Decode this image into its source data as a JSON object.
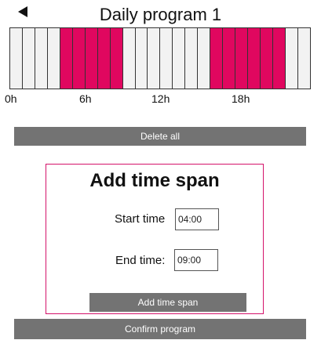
{
  "header": {
    "title": "Daily program 1",
    "back_icon": "back-arrow-icon"
  },
  "timeline": {
    "slots_per_day": 24,
    "active_hours": [
      4,
      5,
      6,
      7,
      8,
      16,
      17,
      18,
      19,
      20,
      21
    ],
    "active_color": "#e0075f",
    "inactive_color": "#f2f2f2",
    "hour_labels": [
      "0h",
      "6h",
      "12h",
      "18h"
    ]
  },
  "delete_all_label": "Delete all",
  "add_panel": {
    "title": "Add time span",
    "start_label": "Start time",
    "start_value": "04:00",
    "end_label": "End time:",
    "end_value": "09:00",
    "add_button_label": "Add time span",
    "border_color": "#d4136a"
  },
  "confirm_label": "Confirm program"
}
